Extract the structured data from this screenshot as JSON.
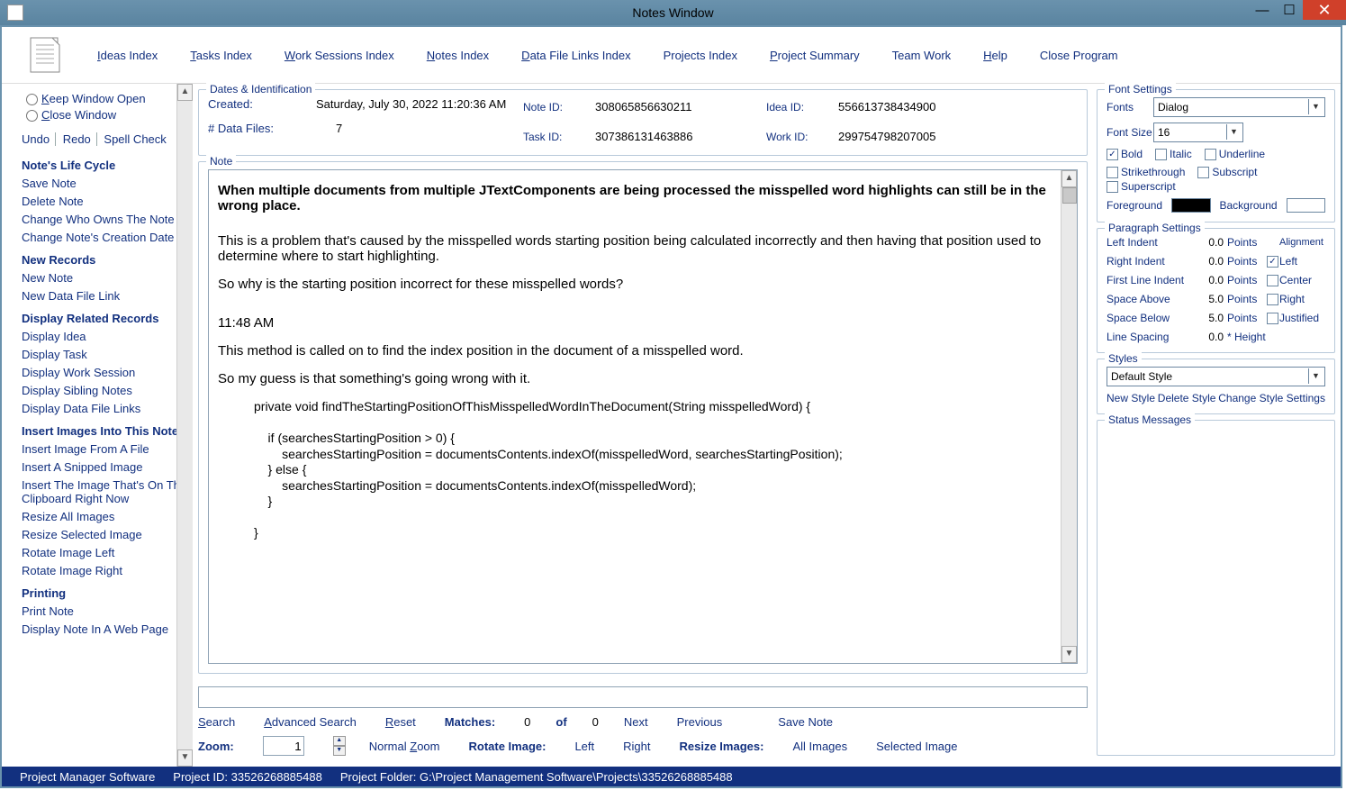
{
  "window": {
    "title": "Notes Window"
  },
  "menu": {
    "ideas": "Ideas Index",
    "tasks": "Tasks Index",
    "work": "Work Sessions Index",
    "notes": "Notes Index",
    "data": "Data File Links Index",
    "projects": "Projects Index",
    "summary": "Project Summary",
    "team": "Team Work",
    "help": "Help",
    "close": "Close Program"
  },
  "left": {
    "keep_open": "Keep Window Open",
    "close_window": "Close Window",
    "undo": "Undo",
    "redo": "Redo",
    "spell": "Spell Check",
    "s1": "Note's Life Cycle",
    "save": "Save Note",
    "delete": "Delete Note",
    "change_owner": "Change Who Owns The Note",
    "change_date": "Change Note's Creation Date",
    "s2": "New Records",
    "new_note": "New Note",
    "new_dfl": "New Data File Link",
    "s3": "Display Related Records",
    "d_idea": "Display Idea",
    "d_task": "Display Task",
    "d_ws": "Display Work Session",
    "d_sib": "Display Sibling Notes",
    "d_dfl": "Display Data File Links",
    "s4": "Insert Images Into This Note",
    "ins_file": "Insert Image From A File",
    "ins_snip": "Insert A Snipped Image",
    "ins_clip": "Insert The Image That's On The Clipboard Right Now",
    "res_all": "Resize All Images",
    "res_sel": "Resize Selected Image",
    "rot_l": "Rotate Image Left",
    "rot_r": "Rotate Image Right",
    "s5": "Printing",
    "print": "Print Note",
    "display_web": "Display Note In A Web Page"
  },
  "ident": {
    "legend": "Dates & Identification",
    "created_lab": "Created:",
    "created_val": "Saturday, July 30, 2022   11:20:36 AM",
    "files_lab": "# Data Files:",
    "files_val": "7",
    "note_id_lab": "Note ID:",
    "note_id": "308065856630211",
    "idea_id_lab": "Idea ID:",
    "idea_id": "556613738434900",
    "task_id_lab": "Task ID:",
    "task_id": "307386131463886",
    "work_id_lab": "Work ID:",
    "work_id": "299754798207005"
  },
  "note": {
    "legend": "Note",
    "head": "When multiple documents from multiple JTextComponents are being processed the misspelled word highlights can still be in the wrong place.",
    "p1": "This is a problem that's caused by the misspelled words starting position being calculated incorrectly and then having that position used to determine where to start highlighting.",
    "p2": "So why is the starting position incorrect for these misspelled words?",
    "ts": "11:48 AM",
    "p3": "This method is called on to find the index position in the document of a misspelled word.",
    "p4": "So my guess is that something's going wrong with it.",
    "code": "private void findTheStartingPositionOfThisMisspelledWordInTheDocument(String misspelledWord) {\n\n    if (searchesStartingPosition > 0) {\n        searchesStartingPosition = documentsContents.indexOf(misspelledWord, searchesStartingPosition);\n    } else {\n        searchesStartingPosition = documentsContents.indexOf(misspelledWord);\n    }\n\n}"
  },
  "searchrow": {
    "search": "Search",
    "adv": "Advanced Search",
    "reset": "Reset",
    "matches_lab": "Matches:",
    "matches": "0",
    "of": "of",
    "total": "0",
    "next": "Next",
    "prev": "Previous",
    "save": "Save Note"
  },
  "zoomrow": {
    "zoom_lab": "Zoom:",
    "zoom": "1",
    "normal": "Normal Zoom",
    "rotate_lab": "Rotate Image:",
    "left": "Left",
    "right": "Right",
    "resize_lab": "Resize Images:",
    "all": "All Images",
    "sel": "Selected Image"
  },
  "fontpanel": {
    "legend": "Font Settings",
    "fonts_lab": "Fonts",
    "font": "Dialog",
    "size_lab": "Font Size",
    "size": "16",
    "bold": "Bold",
    "italic": "Italic",
    "uline": "Underline",
    "strike": "Strikethrough",
    "sub": "Subscript",
    "sup": "Superscript",
    "fg": "Foreground",
    "bg": "Background"
  },
  "parapanel": {
    "legend": "Paragraph Settings",
    "li": "Left Indent",
    "li_v": "0.0",
    "ri": "Right Indent",
    "ri_v": "0.0",
    "fli": "First Line Indent",
    "fli_v": "0.0",
    "sa": "Space Above",
    "sa_v": "5.0",
    "sb": "Space Below",
    "sb_v": "5.0",
    "ls": "Line Spacing",
    "ls_v": "0.0",
    "pts": "Points",
    "height": "* Height",
    "align": "Alignment",
    "left": "Left",
    "center": "Center",
    "right": "Right",
    "just": "Justified"
  },
  "stylepanel": {
    "legend": "Styles",
    "default": "Default Style",
    "new": "New Style",
    "del": "Delete Style",
    "chg": "Change Style Settings"
  },
  "statusmsg": {
    "legend": "Status Messages"
  },
  "statusbar": {
    "app": "Project Manager Software",
    "pid_lab": "Project ID:",
    "pid": "33526268885488",
    "pf_lab": "Project Folder:",
    "pf": "G:\\Project Management Software\\Projects\\33526268885488"
  }
}
